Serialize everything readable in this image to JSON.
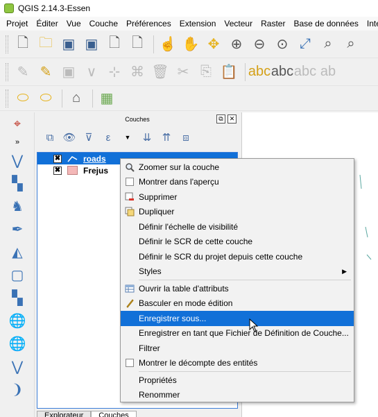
{
  "window": {
    "title": "QGIS 2.14.3-Essen"
  },
  "menubar": {
    "items": [
      "Projet",
      "Éditer",
      "Vue",
      "Couche",
      "Préférences",
      "Extension",
      "Vecteur",
      "Raster",
      "Base de données",
      "Interne"
    ]
  },
  "layers_panel": {
    "title": "Couches",
    "layers": [
      {
        "name": "roads",
        "checked": "✖",
        "selected": true
      },
      {
        "name": "Frejus",
        "checked": "✖",
        "selected": false,
        "color": "#f4b8b8"
      }
    ],
    "tabs": [
      "Explorateur",
      "Couches"
    ]
  },
  "context_menu": {
    "items": [
      {
        "label": "Zoomer sur la couche",
        "icon": "zoom-layer-icon"
      },
      {
        "label": "Montrer dans l'aperçu",
        "icon": "checkbox"
      },
      {
        "label": "Supprimer",
        "icon": "remove-layer-icon"
      },
      {
        "label": "Dupliquer",
        "icon": "duplicate-layer-icon"
      },
      {
        "label": "Définir l'échelle de visibilité",
        "icon": ""
      },
      {
        "label": "Définir le SCR de cette couche",
        "icon": ""
      },
      {
        "label": "Définir le SCR du projet depuis cette couche",
        "icon": ""
      },
      {
        "label": "Styles",
        "icon": "",
        "submenu": "▶"
      },
      {
        "label": "Ouvrir la table d'attributs",
        "icon": "attribute-table-icon"
      },
      {
        "label": "Basculer en mode édition",
        "icon": "pencil-icon"
      },
      {
        "label": "Enregistrer sous...",
        "icon": "",
        "highlighted": true
      },
      {
        "label": "Enregistrer en tant que Fichier de Définition de Couche...",
        "icon": ""
      },
      {
        "label": "Filtrer",
        "icon": ""
      },
      {
        "label": "Montrer le décompte des entités",
        "icon": "checkbox"
      },
      {
        "label": "Propriétés",
        "icon": ""
      },
      {
        "label": "Renommer",
        "icon": ""
      }
    ]
  },
  "colors": {
    "selection": "#1170d8",
    "accent_green": "#8fc641"
  }
}
